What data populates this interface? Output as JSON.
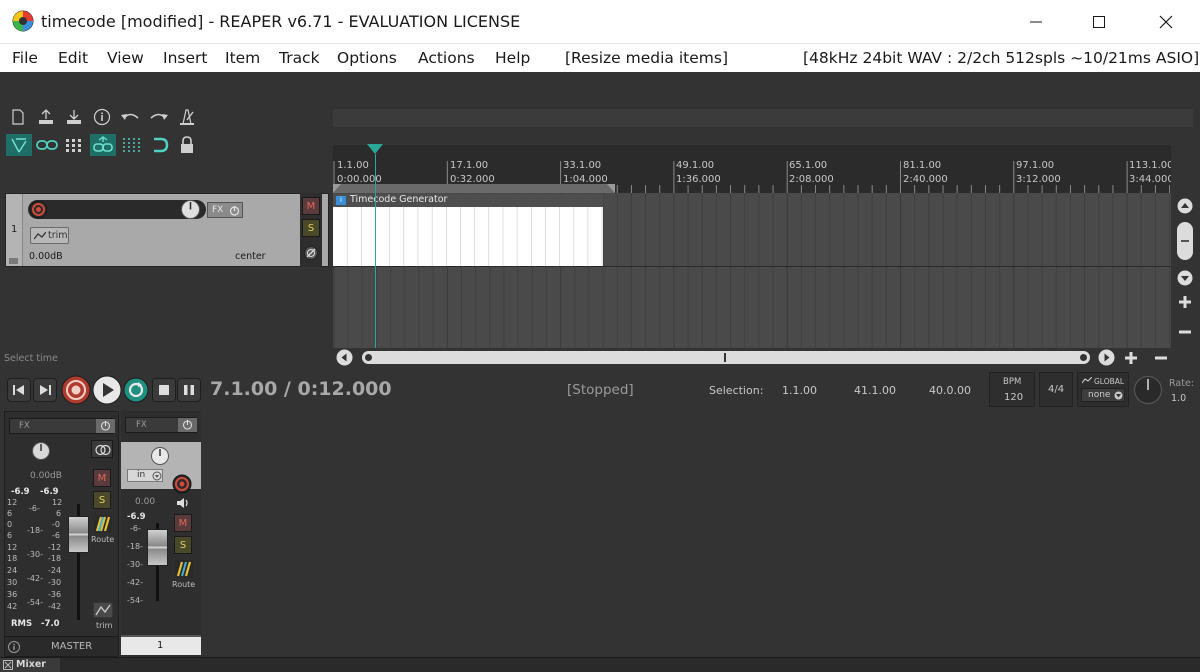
{
  "window": {
    "title": "timecode [modified] - REAPER v6.71 - EVALUATION LICENSE",
    "minimize_icon": "minimize-icon",
    "maximize_icon": "maximize-icon",
    "close_icon": "close-icon"
  },
  "menu": {
    "items": [
      "File",
      "Edit",
      "View",
      "Insert",
      "Item",
      "Track",
      "Options",
      "Actions",
      "Help"
    ],
    "action_hint": "[Resize media items]",
    "audio_status": "[48kHz 24bit WAV : 2/2ch 512spls ~10/21ms ASIO]"
  },
  "ruler": {
    "marks": [
      {
        "bar": "1.1.00",
        "time": "0:00.000"
      },
      {
        "bar": "17.1.00",
        "time": "0:32.000"
      },
      {
        "bar": "33.1.00",
        "time": "1:04.000"
      },
      {
        "bar": "49.1.00",
        "time": "1:36.000"
      },
      {
        "bar": "65.1.00",
        "time": "2:08.000"
      },
      {
        "bar": "81.1.00",
        "time": "2:40.000"
      },
      {
        "bar": "97.1.00",
        "time": "3:12.000"
      },
      {
        "bar": "113.1.00",
        "time": "3:44.000"
      }
    ]
  },
  "track": {
    "number": "1",
    "trim_label": "trim",
    "fx_label": "FX",
    "volume": "0.00dB",
    "pan": "center",
    "mute_label": "M",
    "solo_label": "S"
  },
  "item": {
    "name": "Timecode Generator",
    "badge": "i"
  },
  "status_hint": "Select time",
  "transport": {
    "position": "7.1.00 / 0:12.000",
    "state": "[Stopped]",
    "selection_label": "Selection:",
    "sel_start": "1.1.00",
    "sel_end": "41.1.00",
    "sel_length": "40.0.00",
    "bpm_label": "BPM",
    "bpm_value": "120",
    "time_sig": "4/4",
    "global_label": "GLOBAL",
    "global_value": "none",
    "rate_label": "Rate:",
    "rate_value": "1.0"
  },
  "mixer": {
    "master": {
      "fx_label": "FX",
      "volume": "0.00dB",
      "peak_l": "-6.9",
      "peak_r": "-6.9",
      "mute_label": "M",
      "solo_label": "S",
      "route_label": "Route",
      "scale_left": [
        "12",
        "6",
        "0",
        "6",
        "12",
        "18",
        "24",
        "30",
        "36",
        "42"
      ],
      "scale_mid": [
        "-6-",
        "-18-",
        "-30-",
        "-42-",
        "-54-"
      ],
      "scale_right": [
        "12",
        "6",
        "-0",
        "-6",
        "-12",
        "-18",
        "-24",
        "-30",
        "-36",
        "-42"
      ],
      "rms_label": "RMS",
      "rms_value": "-7.0",
      "trim_label": "trim",
      "name": "MASTER"
    },
    "track1": {
      "fx_label": "FX",
      "input_label": "in",
      "volume": "0.00",
      "peak": "-6.9",
      "scale": [
        "-6-",
        "-18-",
        "-30-",
        "-42-",
        "-54-"
      ],
      "mute_label": "M",
      "solo_label": "S",
      "route_label": "Route",
      "name": "1"
    },
    "tab_label": "Mixer"
  },
  "colors": {
    "accent_teal": "#2aa89a",
    "record_red": "#c0392b",
    "background": "#333333"
  }
}
